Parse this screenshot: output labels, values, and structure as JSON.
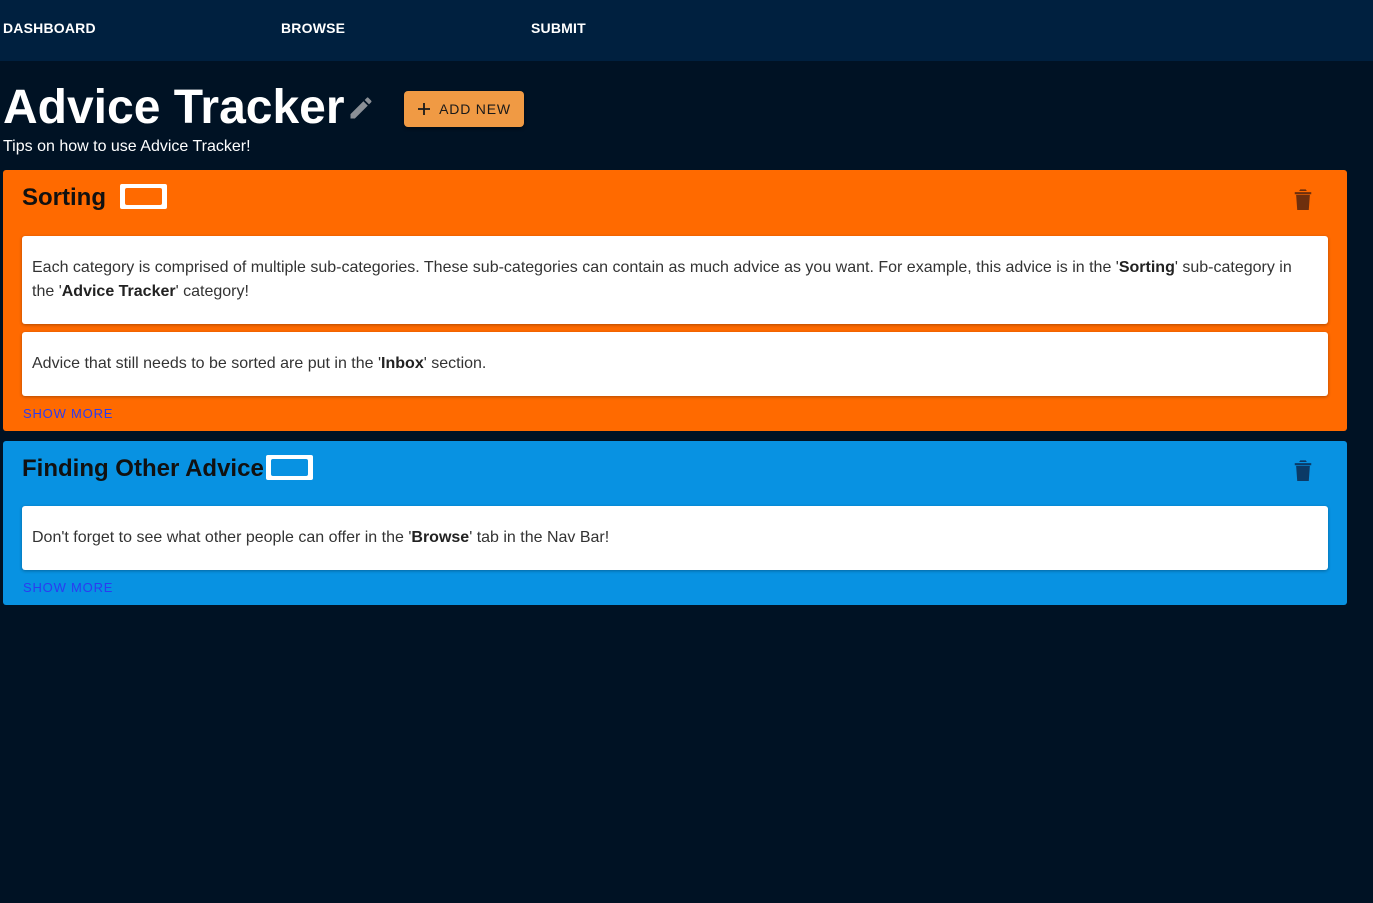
{
  "nav": {
    "items": [
      {
        "label": "DASHBOARD"
      },
      {
        "label": "BROWSE"
      },
      {
        "label": "SUBMIT"
      }
    ]
  },
  "header": {
    "title": "Advice Tracker",
    "subtitle": "Tips on how to use Advice Tracker!",
    "add_new_label": "ADD NEW"
  },
  "categories": [
    {
      "title": "Sorting",
      "color": "#ff6a00",
      "advice": [
        {
          "parts": [
            {
              "t": "Each category is comprised of multiple sub-categories. These sub-categories can contain as much advice as you want. For example, this advice is in the '"
            },
            {
              "t": "Sorting",
              "b": true
            },
            {
              "t": "' sub-category in the '"
            },
            {
              "t": "Advice Tracker",
              "b": true
            },
            {
              "t": "' category!"
            }
          ]
        },
        {
          "parts": [
            {
              "t": "Advice that still needs to be sorted are put in the '"
            },
            {
              "t": "Inbox",
              "b": true
            },
            {
              "t": "' section."
            }
          ]
        }
      ],
      "show_more_label": "SHOW MORE"
    },
    {
      "title": "Finding Other Advice",
      "color": "#0892e2",
      "advice": [
        {
          "parts": [
            {
              "t": "Don't forget to see what other people can offer in the '"
            },
            {
              "t": "Browse",
              "b": true
            },
            {
              "t": "' tab in the Nav Bar!"
            }
          ]
        }
      ],
      "show_more_label": "SHOW MORE"
    }
  ],
  "colors": {
    "page_bg": "#001224",
    "navbar_bg": "#00203f",
    "add_new_bg": "#f09a44",
    "show_more": "#2b3cf0"
  },
  "icons": {
    "edit": "pencil-icon",
    "add": "plus-icon",
    "delete": "trash-icon"
  }
}
